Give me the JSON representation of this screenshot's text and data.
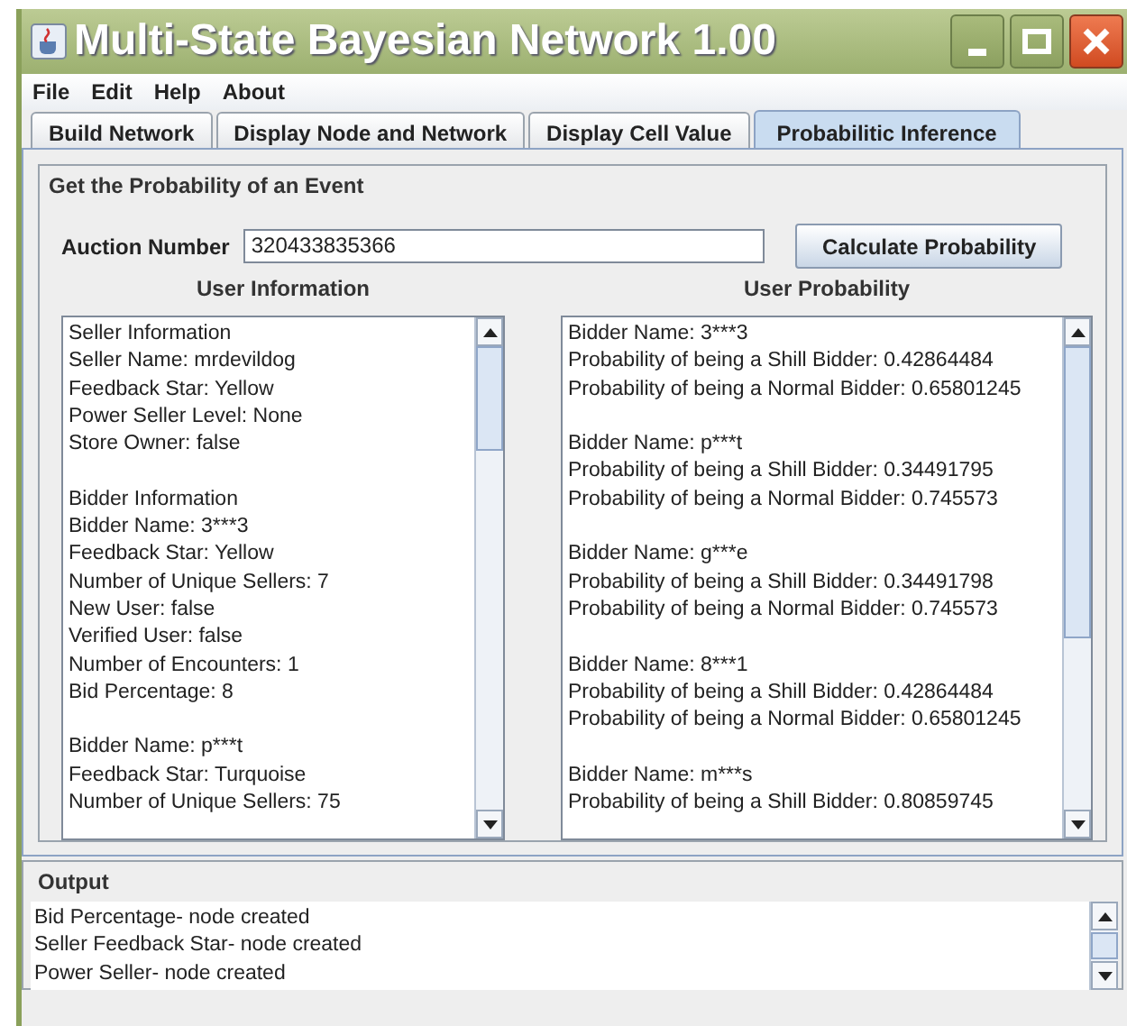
{
  "window": {
    "title": "Multi-State Bayesian Network 1.00"
  },
  "menu": [
    "File",
    "Edit",
    "Help",
    "About"
  ],
  "tabs": [
    {
      "label": "Build Network",
      "selected": false
    },
    {
      "label": "Display Node and Network",
      "selected": false
    },
    {
      "label": "Display Cell Value",
      "selected": false
    },
    {
      "label": "Probabilitic Inference",
      "selected": true
    }
  ],
  "group_title": "Get the Probability of an Event",
  "auction": {
    "label": "Auction Number",
    "value": "320433835366",
    "button": "Calculate Probability"
  },
  "user_information": {
    "heading": "User Information",
    "blocks": [
      [
        "Seller Information",
        "Seller Name: mrdevildog",
        "Feedback Star: Yellow",
        "Power Seller Level: None",
        "Store Owner: false"
      ],
      [
        "Bidder Information",
        "Bidder Name: 3***3",
        "Feedback Star: Yellow",
        "Number of Unique Sellers: 7",
        "New User: false",
        "Verified User: false",
        "Number of Encounters: 1",
        "Bid Percentage: 8"
      ],
      [
        "Bidder Name: p***t",
        "Feedback Star: Turquoise",
        "Number of Unique Sellers: 75"
      ]
    ]
  },
  "user_probability": {
    "heading": "User Probability",
    "blocks": [
      [
        "Bidder Name: 3***3",
        "Probability of being a Shill Bidder: 0.42864484",
        "Probability of being a Normal Bidder: 0.65801245"
      ],
      [
        "Bidder Name: p***t",
        "Probability of being a Shill Bidder: 0.34491795",
        "Probability of being a Normal Bidder: 0.745573"
      ],
      [
        "Bidder Name: g***e",
        "Probability of being a Shill Bidder: 0.34491798",
        "Probability of being a Normal Bidder: 0.745573"
      ],
      [
        "Bidder Name: 8***1",
        "Probability of being a Shill Bidder: 0.42864484",
        "Probability of being a Normal Bidder: 0.65801245"
      ],
      [
        "Bidder Name: m***s",
        "Probability of being a Shill Bidder: 0.80859745"
      ]
    ]
  },
  "output": {
    "title": "Output",
    "lines": [
      "Bid Percentage- node created",
      "Seller Feedback Star- node created",
      "Power Seller- node created"
    ]
  }
}
